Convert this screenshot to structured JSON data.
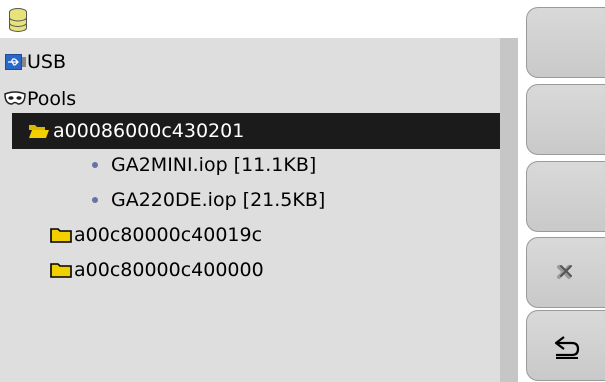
{
  "header": {
    "icon": "database-icon"
  },
  "tree": {
    "items": [
      {
        "label": "USB",
        "icon": "usb-icon",
        "level": 0
      },
      {
        "label": "Pools",
        "icon": "mask-icon",
        "level": 0
      },
      {
        "label": "a00086000c430201",
        "icon": "folder-open-icon",
        "level": 1,
        "selected": true
      },
      {
        "label": "GA2MINI.iop [11.1KB]",
        "icon": "bullet",
        "level": 2
      },
      {
        "label": "GA220DE.iop [21.5KB]",
        "icon": "bullet",
        "level": 2
      },
      {
        "label": "a00c80000c40019c",
        "icon": "folder-icon",
        "level": 1
      },
      {
        "label": "a00c80000c400000",
        "icon": "folder-icon",
        "level": 1
      }
    ]
  },
  "softkeys": [
    {
      "icon": ""
    },
    {
      "icon": ""
    },
    {
      "icon": ""
    },
    {
      "icon": "cancel-x-icon"
    },
    {
      "icon": "back-return-icon"
    }
  ],
  "colors": {
    "selection": "#1b1b1b",
    "panel": "#dedede",
    "folder": "#f2d000",
    "bullet": "#6673a4"
  }
}
